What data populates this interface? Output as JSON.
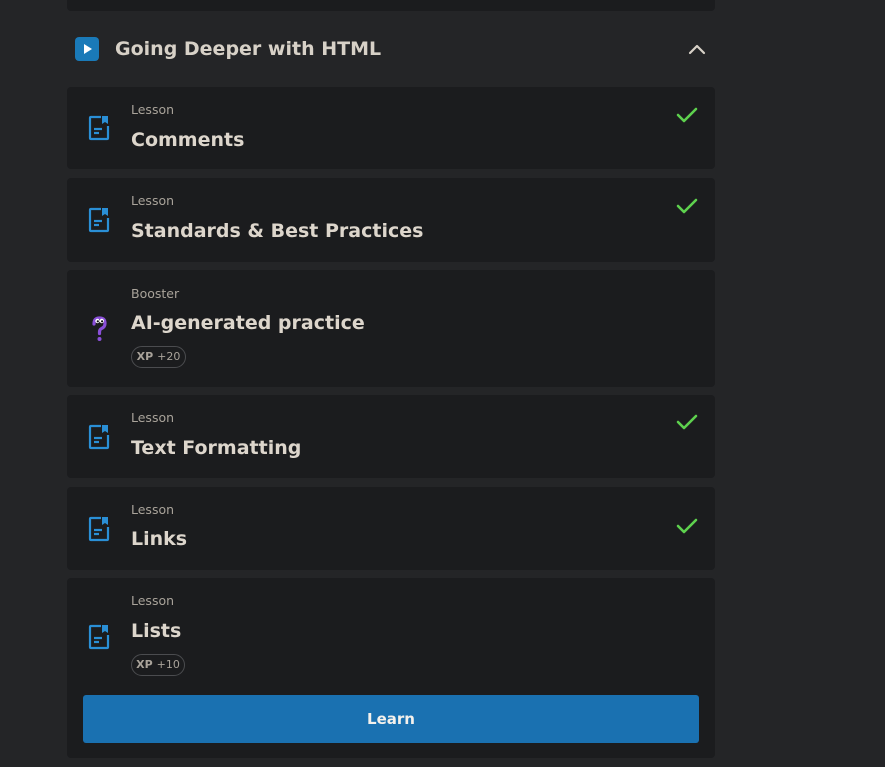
{
  "module": {
    "title": "Going Deeper with HTML"
  },
  "items": [
    {
      "kind": "Lesson",
      "title": "Comments",
      "completed": true,
      "icon": "lesson-document-icon"
    },
    {
      "kind": "Lesson",
      "title": "Standards & Best Practices",
      "completed": true,
      "icon": "lesson-document-icon"
    },
    {
      "kind": "Booster",
      "title": "AI-generated practice",
      "completed": false,
      "icon": "question-mascot-icon",
      "xp_label": "XP",
      "xp_value": "+20"
    },
    {
      "kind": "Lesson",
      "title": "Text Formatting",
      "completed": true,
      "icon": "lesson-document-icon"
    },
    {
      "kind": "Lesson",
      "title": "Links",
      "completed": true,
      "icon": "lesson-document-icon"
    },
    {
      "kind": "Lesson",
      "title": "Lists",
      "completed": false,
      "icon": "lesson-document-icon",
      "xp_label": "XP",
      "xp_value": "+10"
    }
  ],
  "actions": {
    "learn_label": "Learn"
  },
  "colors": {
    "accent": "#1a71b1",
    "check": "#5ed14e",
    "lesson_icon": "#2a8fd6",
    "booster_icon": "#8a4fd8"
  }
}
